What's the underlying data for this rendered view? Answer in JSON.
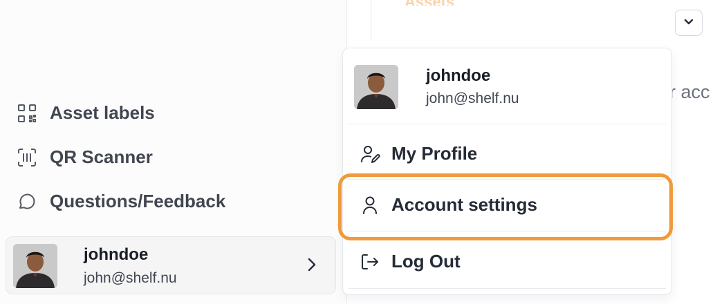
{
  "colors": {
    "accent": "#ef9a3c",
    "text": "#252b37",
    "muted": "#414651"
  },
  "main": {
    "header_fade": "Assets",
    "bg_text": "r acc",
    "chevron_icon": "chevron-down-icon"
  },
  "sidebar": {
    "items": [
      {
        "label": "Asset labels",
        "icon": "qr-code-icon"
      },
      {
        "label": "QR Scanner",
        "icon": "scan-icon"
      },
      {
        "label": "Questions/Feedback",
        "icon": "message-circle-icon"
      }
    ],
    "user": {
      "name": "johndoe",
      "email": "john@shelf.nu",
      "chevron_icon": "chevron-right-icon"
    }
  },
  "dropdown": {
    "user": {
      "name": "johndoe",
      "email": "john@shelf.nu"
    },
    "items": [
      {
        "label": "My Profile",
        "icon": "user-edit-icon"
      },
      {
        "label": "Account settings",
        "icon": "user-icon",
        "highlighted": true
      },
      {
        "label": "Log Out",
        "icon": "log-out-icon"
      }
    ]
  }
}
